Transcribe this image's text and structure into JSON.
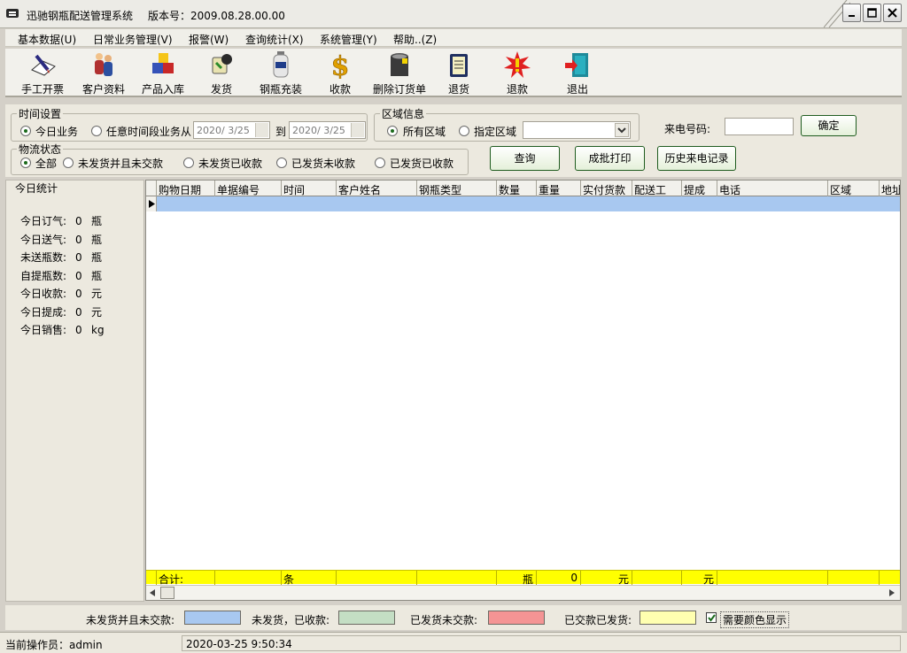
{
  "window": {
    "title": "迅驰钢瓶配送管理系统",
    "version_label": "版本号：2009.08.28.00.00"
  },
  "menu": [
    {
      "label": "基本数据(U)"
    },
    {
      "label": "日常业务管理(V)"
    },
    {
      "label": "报警(W)"
    },
    {
      "label": "查询统计(X)"
    },
    {
      "label": "系统管理(Y)"
    },
    {
      "label": "帮助..(Z)"
    }
  ],
  "toolbar": [
    {
      "label": "手工开票",
      "icon": "pen-paper-icon"
    },
    {
      "label": "客户资料",
      "icon": "people-icon"
    },
    {
      "label": "产品入库",
      "icon": "boxes-icon"
    },
    {
      "label": "发货",
      "icon": "dispatch-icon"
    },
    {
      "label": "钢瓶充装",
      "icon": "gas-cylinder-icon"
    },
    {
      "label": "收款",
      "icon": "dollar-icon"
    },
    {
      "label": "删除订货单",
      "icon": "trash-can-icon"
    },
    {
      "label": "退货",
      "icon": "return-clipboard-icon"
    },
    {
      "label": "退款",
      "icon": "refund-burst-icon"
    },
    {
      "label": "退出",
      "icon": "exit-door-icon"
    }
  ],
  "filters": {
    "time_group": "时间设置",
    "today_label": "今日业务",
    "range_label": "任意时间段业务从",
    "date_from": "2020/ 3/25",
    "to_label": "到",
    "date_to": "2020/ 3/25",
    "area_group": "区域信息",
    "all_area_label": "所有区域",
    "specified_area_label": "指定区域",
    "specified_area_value": "",
    "caller_label": "来电号码:",
    "caller_value": "",
    "confirm_label": "确定",
    "logistics_group": "物流状态",
    "status_options": [
      "全部",
      "未发货并且未交款",
      "未发货已收款",
      "已发货未收款",
      "已发货已收款"
    ],
    "query_label": "查询",
    "batch_print_label": "成批打印",
    "call_history_label": "历史来电记录"
  },
  "stats": {
    "title": "今日统计",
    "rows": [
      {
        "label": "今日订气:",
        "value": "0",
        "unit": "瓶"
      },
      {
        "label": "今日送气:",
        "value": "0",
        "unit": "瓶"
      },
      {
        "label": "未送瓶数:",
        "value": "0",
        "unit": "瓶"
      },
      {
        "label": "自提瓶数:",
        "value": "0",
        "unit": "瓶"
      },
      {
        "label": "今日收款:",
        "value": "0",
        "unit": "元"
      },
      {
        "label": "今日提成:",
        "value": "0",
        "unit": "元"
      },
      {
        "label": "今日销售:",
        "value": "0",
        "unit": "kg"
      }
    ]
  },
  "grid": {
    "columns": [
      "购物日期",
      "单据编号",
      "时间",
      "客户姓名",
      "钢瓶类型",
      "数量",
      "重量",
      "实付货款",
      "配送工",
      "提成",
      "电话",
      "区域",
      "地址"
    ],
    "summary": {
      "label": "合计:",
      "count_unit": "条",
      "qty_unit": "瓶",
      "weight": "0",
      "amount_unit": "元",
      "commission_unit": "元"
    }
  },
  "legend": {
    "items": [
      {
        "label": "未发货并且未交款:",
        "color": "#a8c8f0"
      },
      {
        "label": "未发货，已收款:",
        "color": "#c4dec4"
      },
      {
        "label": "已发货未交款:",
        "color": "#f49494"
      },
      {
        "label": "已交款已发货:",
        "color": "#ffffb0"
      }
    ],
    "color_display_label": "需要颜色显示",
    "color_display_checked": true
  },
  "status": {
    "operator": "当前操作员：admin",
    "datetime": "2020-03-25 9:50:34"
  }
}
